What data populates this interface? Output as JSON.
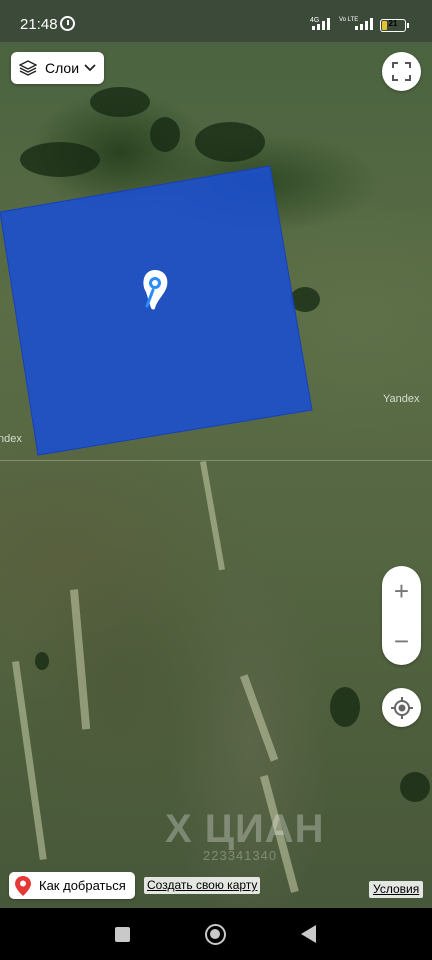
{
  "status_bar": {
    "time": "21:48",
    "network_labels": [
      "4G",
      "Vo LTE"
    ],
    "battery": "21",
    "battery_level": 0.21,
    "battery_color": "#e5c233"
  },
  "map": {
    "provider_marks": [
      "Yandex",
      "ndex"
    ],
    "watermark": {
      "main": "Х ЦИАН",
      "sub": "223341340"
    },
    "plot_color": "#1a4fd1",
    "icons": [
      "location-pin-icon"
    ]
  },
  "controls": {
    "layers_label": "Слои",
    "route_label": "Как добраться",
    "create_map_link": "Создать свою карту",
    "terms_link": "Условия",
    "zoom_in": "+",
    "zoom_out": "−"
  }
}
